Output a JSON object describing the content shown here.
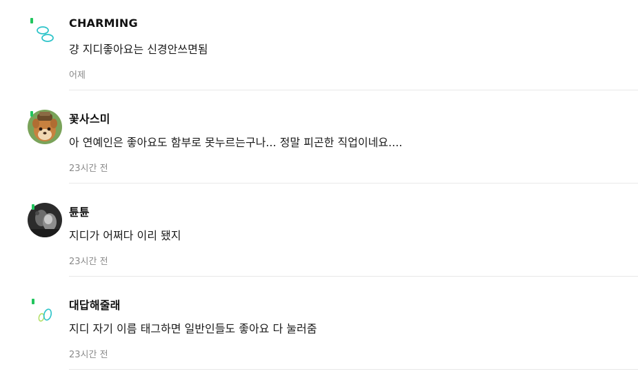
{
  "comments": [
    {
      "username": "CHARMING",
      "text": "걍 지디좋아요는 신경안쓰면됨",
      "time": "어제",
      "avatar_icon": "default-bubbles-avatar-icon",
      "badge_color": "#22c55e"
    },
    {
      "username": "꽃사스미",
      "text": "아 연예인은 좋아요도 함부로 못누르는구나... 정말 피곤한 직업이네요....",
      "time": "23시간 전",
      "avatar_icon": "deer-character-avatar-icon",
      "badge_color": "#22c55e"
    },
    {
      "username": "튠튠",
      "text": "지디가 어쩌다 이리 됐지",
      "time": "23시간 전",
      "avatar_icon": "photo-avatar-icon",
      "badge_color": "#22c55e"
    },
    {
      "username": "대답해줄래",
      "text": "지디 자기 이름 태그하면 일반인들도 좋아요 다 눌러줌",
      "time": "23시간 전",
      "avatar_icon": "default-bubbles-avatar-icon",
      "badge_color": "#22c55e"
    }
  ],
  "colors": {
    "badge_green": "#22c55e",
    "bubble_teal": "#2ec4c9",
    "bubble_green": "#b5e06a",
    "timestamp": "#8a8a8a",
    "divider": "#e8e8e8"
  }
}
